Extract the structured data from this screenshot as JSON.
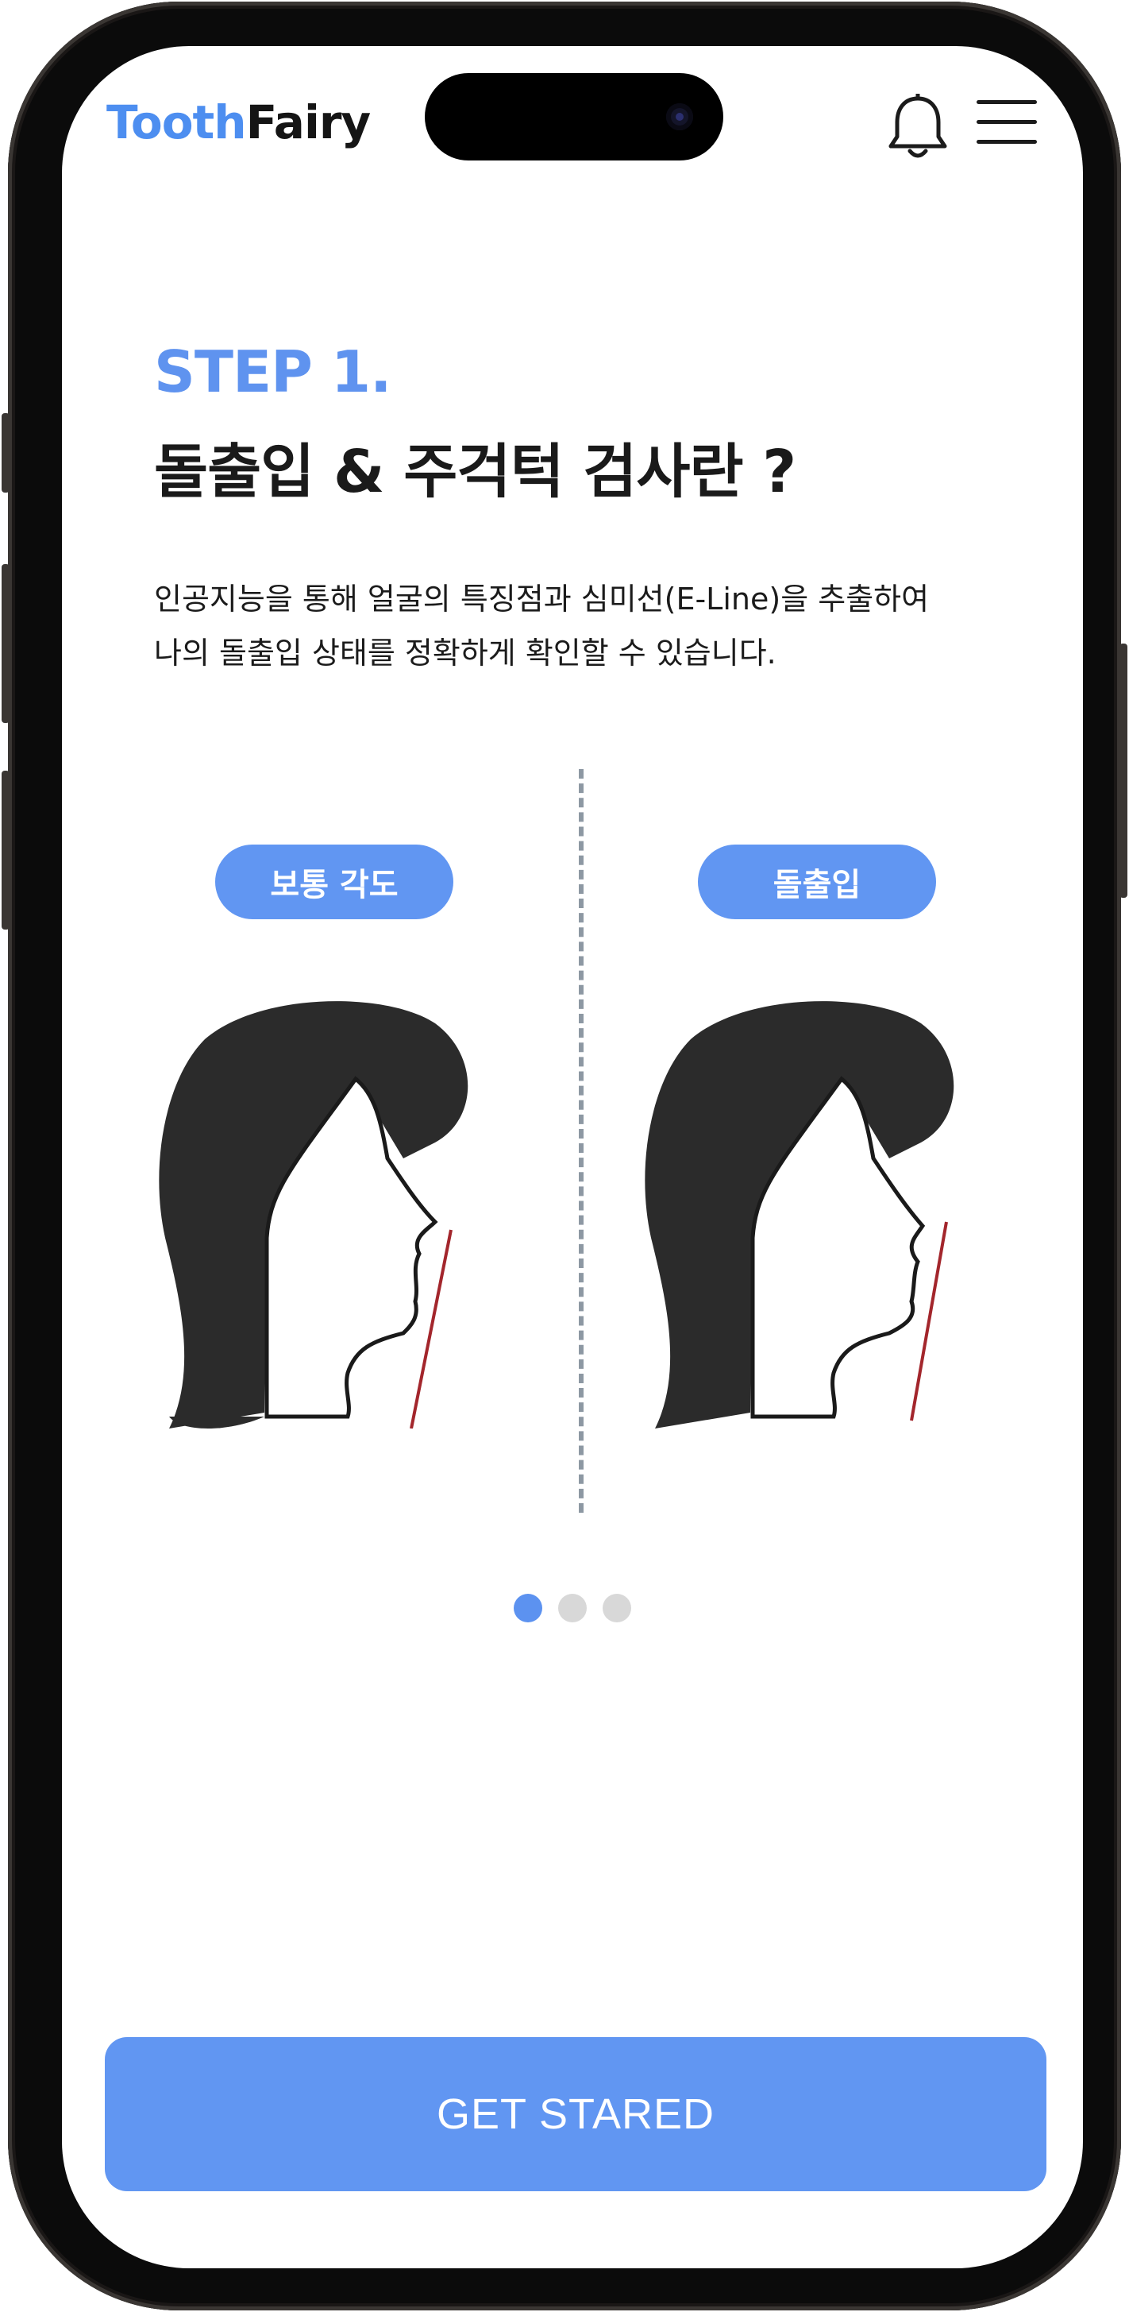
{
  "header": {
    "logo_part1": "Tooth",
    "logo_part2": "Fairy",
    "bell_icon": "bell-icon",
    "menu_icon": "hamburger-menu-icon"
  },
  "content": {
    "step_label": "STEP 1.",
    "title": "돌출입 & 주걱턱 검사란 ?",
    "description_line1": "인공지능을 통해 얼굴의 특징점과 심미선(E-Line)을 추출하여",
    "description_line2": "나의 돌출입 상태를 정확하게 확인할 수 있습니다.",
    "comparison": [
      {
        "label": "보통 각도",
        "icon": "normal-profile-illustration"
      },
      {
        "label": "돌출입",
        "icon": "protruding-mouth-profile-illustration"
      }
    ]
  },
  "pagination": {
    "total": 3,
    "active": 1
  },
  "cta": {
    "label": "GET STARED"
  },
  "colors": {
    "accent": "#6196f2",
    "logo_blue": "#4d8ef0",
    "eline": "#a3262c",
    "hair": "#2b2b2b"
  }
}
